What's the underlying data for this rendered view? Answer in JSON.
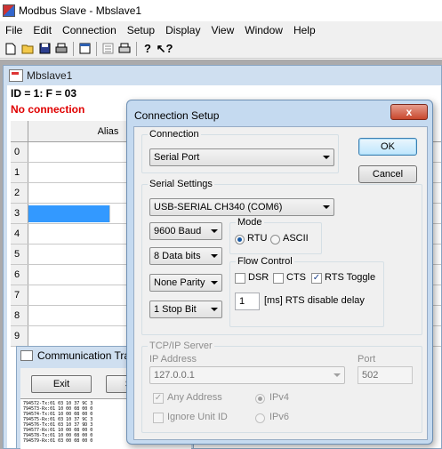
{
  "app": {
    "title": "Modbus Slave - Mbslave1"
  },
  "menu": [
    "File",
    "Edit",
    "Connection",
    "Setup",
    "Display",
    "View",
    "Window",
    "Help"
  ],
  "toolbar": {
    "icons": [
      "new-icon",
      "open-icon",
      "save-icon",
      "print-icon",
      "window-icon",
      "comm-traffic-icon",
      "print-preview-icon",
      "help-icon",
      "context-help-icon"
    ]
  },
  "child": {
    "title": "Mbslave1",
    "id_line": "ID = 1: F = 03",
    "status": "No connection",
    "grid": {
      "alias_header": "Alias",
      "rows": [
        "0",
        "1",
        "2",
        "3",
        "4",
        "5",
        "6",
        "7",
        "8",
        "9"
      ],
      "selected_row": "3"
    }
  },
  "comm": {
    "title": "Communication Tra",
    "exit_label": "Exit",
    "stop_label": "Sto",
    "log": [
      "794572-Tx:01 03 10 37 9C 3",
      "794573-Rx:01 10 00 08 00 0",
      "794574-Tx:01 10 00 08 00 0",
      "794575-Rx:01 03 10 37 9C 3",
      "794576-Tx:01 03 10 37 9D 3",
      "794577-Rx:01 10 00 08 00 0",
      "794578-Tx:01 10 00 08 00 0",
      "794579-Rx:01 03 00 08 00 0"
    ]
  },
  "dialog": {
    "title": "Connection Setup",
    "close_glyph": "x",
    "connection": {
      "label": "Connection",
      "value": "Serial Port"
    },
    "ok_label": "OK",
    "cancel_label": "Cancel",
    "serial": {
      "label": "Serial Settings",
      "port": "USB-SERIAL CH340 (COM6)",
      "baud": "9600 Baud",
      "data_bits": "8 Data bits",
      "parity": "None Parity",
      "stop_bits": "1 Stop Bit",
      "mode": {
        "label": "Mode",
        "rtu": "RTU",
        "ascii": "ASCII",
        "selected": "RTU"
      },
      "flow": {
        "label": "Flow Control",
        "dsr": "DSR",
        "cts": "CTS",
        "rts_toggle": "RTS Toggle",
        "rts_toggle_checked": true,
        "rts_delay_value": "1",
        "rts_delay_label": "[ms] RTS disable delay"
      }
    },
    "tcp": {
      "label": "TCP/IP Server",
      "ip_label": "IP Address",
      "ip_value": "127.0.0.1",
      "port_label": "Port",
      "port_value": "502",
      "any_address": "Any Address",
      "any_address_checked": true,
      "ignore_unit_id": "Ignore Unit ID",
      "ipv4": "IPv4",
      "ipv6": "IPv6",
      "ip_version_selected": "IPv4"
    }
  },
  "colors": {
    "error_text": "#e00000",
    "selection": "#3399ff",
    "dialog_frame": "#c5daf0",
    "close_button": "#c8472d"
  }
}
